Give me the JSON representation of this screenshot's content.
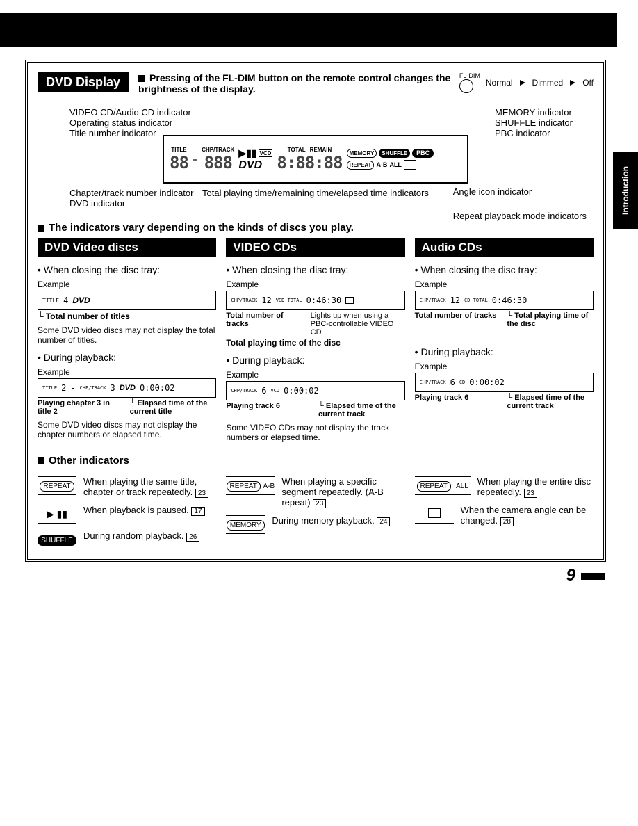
{
  "side_tab": "Introduction",
  "section_title": "DVD Display",
  "fl_note": "Pressing of the FL-DIM button on the remote control changes the brightness of the display.",
  "fldim": {
    "label": "FL-DIM",
    "s1": "Normal",
    "s2": "Dimmed",
    "s3": "Off"
  },
  "callouts_top_left": [
    "VIDEO CD/Audio CD indicator",
    "Operating status indicator",
    "Title number indicator"
  ],
  "callouts_top_right": [
    "MEMORY indicator",
    "SHUFFLE indicator",
    "PBC indicator"
  ],
  "display": {
    "title_label": "TITLE",
    "chp_label": "CHP/TRACK",
    "title_digits": "88",
    "chp_digits": "888",
    "vcd": "VCD",
    "dvd": "DVD",
    "total": "TOTAL",
    "remain": "REMAIN",
    "time_digits": "8:88:88",
    "memory": "MEMORY",
    "shuffle": "SHUFFLE",
    "pbc": "PBC",
    "repeat": "REPEAT",
    "ab": "A-B",
    "all": "ALL"
  },
  "callouts_bot_left": [
    "Chapter/track number indicator",
    "DVD indicator"
  ],
  "callouts_bot_right": [
    "Angle icon indicator",
    "Repeat playback mode indicators"
  ],
  "callout_center": "Total playing time/remaining time/elapsed time indicators",
  "vary_note": "The indicators vary depending on the kinds of discs you play.",
  "columns": [
    {
      "heading": "DVD Video discs",
      "closing_label": "When closing the disc tray:",
      "example_label": "Example",
      "ex1_disp": {
        "label": "TITLE",
        "val": "4",
        "tag": "DVD"
      },
      "ex1_cap": "Total number of titles",
      "note1": "Some DVD video discs may not display the total number of titles.",
      "playback_label": "During playback:",
      "ex2_disp": {
        "title": "2",
        "chp": "3",
        "tag": "DVD",
        "time": "0:00:02"
      },
      "ex2_cap_left": "Playing chapter 3 in title 2",
      "ex2_cap_right": "Elapsed time of the current title",
      "note2": "Some DVD video discs may not display the chapter numbers or elapsed time."
    },
    {
      "heading": "VIDEO CDs",
      "closing_label": "When closing the disc tray:",
      "example_label": "Example",
      "ex1_disp": {
        "label": "CHP/TRACK",
        "val": "12",
        "tag": "VCD TOTAL",
        "time": "0:46:30"
      },
      "ex1_cap_left": "Total number of tracks",
      "ex1_cap_right": "Lights up when using a PBC-controllable VIDEO CD",
      "ex1_cap_bottom": "Total playing time of the disc",
      "playback_label": "During playback:",
      "ex2_disp": {
        "val": "6",
        "tag": "VCD",
        "time": "0:00:02"
      },
      "ex2_cap_left": "Playing track 6",
      "ex2_cap_right": "Elapsed time of the current track",
      "note2": "Some VIDEO CDs may not display the track numbers or elapsed time."
    },
    {
      "heading": "Audio CDs",
      "closing_label": "When closing the disc tray:",
      "example_label": "Example",
      "ex1_disp": {
        "label": "CHP/TRACK",
        "val": "12",
        "tag": "CD TOTAL",
        "time": "0:46:30"
      },
      "ex1_cap_left": "Total number of tracks",
      "ex1_cap_right": "Total playing time of the disc",
      "playback_label": "During playback:",
      "ex2_disp": {
        "val": "6",
        "tag": "CD",
        "time": "0:00:02"
      },
      "ex2_cap_left": "Playing track 6",
      "ex2_cap_right": "Elapsed time of the current track"
    }
  ],
  "other_heading": "Other indicators",
  "indicators": {
    "repeat": {
      "icon": "REPEAT",
      "text": "When playing the same title, chapter or track repeatedly.",
      "ref": "23"
    },
    "pause": {
      "icon": "▶ ▮▮",
      "text": "When playback is paused.",
      "ref": "17"
    },
    "shuffle": {
      "icon": "SHUFFLE",
      "text": "During random playback.",
      "ref": "26"
    },
    "repeat_ab": {
      "icon": "REPEAT A-B",
      "text": "When playing a specific segment repeatedly. (A-B repeat)",
      "ref": "23"
    },
    "memory": {
      "icon": "MEMORY",
      "text": "During memory playback.",
      "ref": "24"
    },
    "repeat_all": {
      "icon": "REPEAT   ALL",
      "text": "When playing the entire disc repeatedly.",
      "ref": "23"
    },
    "angle": {
      "text": "When the camera angle can be changed.",
      "ref": "28"
    }
  },
  "page_number": "9"
}
